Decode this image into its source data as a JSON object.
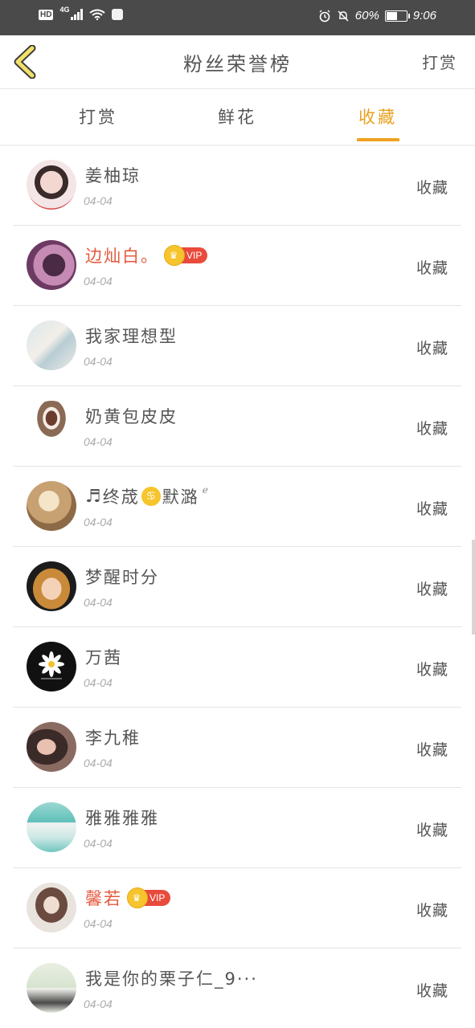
{
  "statusbar": {
    "hd": "HD",
    "network": "4G",
    "battery_pct": "60%",
    "battery_level": 0.6,
    "time": "9:06"
  },
  "header": {
    "title": "粉丝荣誉榜",
    "action_label": "打赏"
  },
  "tabs": [
    {
      "label": "打赏",
      "active": false
    },
    {
      "label": "鲜花",
      "active": false
    },
    {
      "label": "收藏",
      "active": true
    }
  ],
  "rows": [
    {
      "name": "姜柚琼",
      "date": "04-04",
      "action": "收藏"
    },
    {
      "name": "边灿白。",
      "date": "04-04",
      "action": "收藏",
      "vip": "VIP"
    },
    {
      "name": "我家理想型",
      "date": "04-04",
      "action": "收藏"
    },
    {
      "name": "奶黄包皮皮",
      "date": "04-04",
      "action": "收藏"
    },
    {
      "name_prefix": "♬",
      "name": "终荿",
      "name_mid": "♋",
      "name_suffix": "默潞",
      "name_sup": "ℯ",
      "date": "04-04",
      "action": "收藏"
    },
    {
      "name": "梦醒时分",
      "date": "04-04",
      "action": "收藏"
    },
    {
      "name": "万茜",
      "date": "04-04",
      "action": "收藏"
    },
    {
      "name": "李九稚",
      "date": "04-04",
      "action": "收藏"
    },
    {
      "name": "雅雅雅雅",
      "date": "04-04",
      "action": "收藏"
    },
    {
      "name": "馨若",
      "date": "04-04",
      "action": "收藏",
      "vip": "VIP"
    },
    {
      "name": "我是你的栗子仁_9···",
      "date": "04-04",
      "action": "收藏"
    }
  ],
  "colors": {
    "accent": "#e8a21f",
    "vip_name": "#e45a3d",
    "vip_tag": "#e84b3b"
  }
}
